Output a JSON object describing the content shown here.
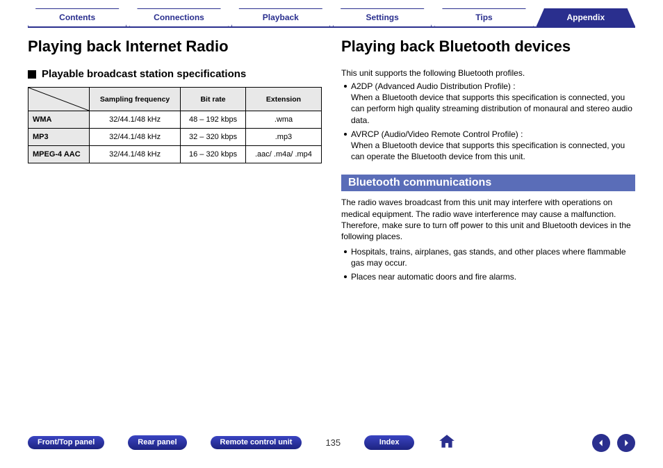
{
  "nav": {
    "tabs": [
      {
        "label": "Contents"
      },
      {
        "label": "Connections"
      },
      {
        "label": "Playback"
      },
      {
        "label": "Settings"
      },
      {
        "label": "Tips"
      },
      {
        "label": "Appendix"
      }
    ],
    "active": 5
  },
  "left": {
    "heading": "Playing back Internet Radio",
    "subheading": "Playable broadcast station specifications",
    "table": {
      "headers": {
        "sampling": "Sampling frequency",
        "bitrate": "Bit rate",
        "ext": "Extension"
      },
      "rows": [
        {
          "name": "WMA",
          "sampling": "32/44.1/48 kHz",
          "bitrate": "48 – 192 kbps",
          "ext": ".wma"
        },
        {
          "name": "MP3",
          "sampling": "32/44.1/48 kHz",
          "bitrate": "32 – 320 kbps",
          "ext": ".mp3"
        },
        {
          "name": "MPEG-4 AAC",
          "sampling": "32/44.1/48 kHz",
          "bitrate": "16 – 320 kbps",
          "ext": ".aac/ .m4a/ .mp4"
        }
      ]
    }
  },
  "right": {
    "heading": "Playing back Bluetooth devices",
    "intro": "This unit supports the following Bluetooth profiles.",
    "profiles": [
      {
        "label": "A2DP (Advanced Audio Distribution Profile) :",
        "desc": "When a Bluetooth device that supports this specification is connected, you can perform high quality streaming distribution of monaural and stereo audio data."
      },
      {
        "label": "AVRCP (Audio/Video Remote Control Profile) :",
        "desc": "When a Bluetooth device that supports this specification is connected, you can operate the Bluetooth device from this unit."
      }
    ],
    "section": "Bluetooth communications",
    "para": "The radio waves broadcast from this unit may interfere with operations on medical equipment. The radio wave interference may cause a malfunction. Therefore, make sure to turn off power to this unit and Bluetooth devices in the following places.",
    "places": [
      "Hospitals, trains, airplanes, gas stands, and other places where flammable gas may occur.",
      "Places near automatic doors and fire alarms."
    ]
  },
  "footer": {
    "front": "Front/Top panel",
    "rear": "Rear panel",
    "remote": "Remote control unit",
    "page": "135",
    "index": "Index"
  }
}
